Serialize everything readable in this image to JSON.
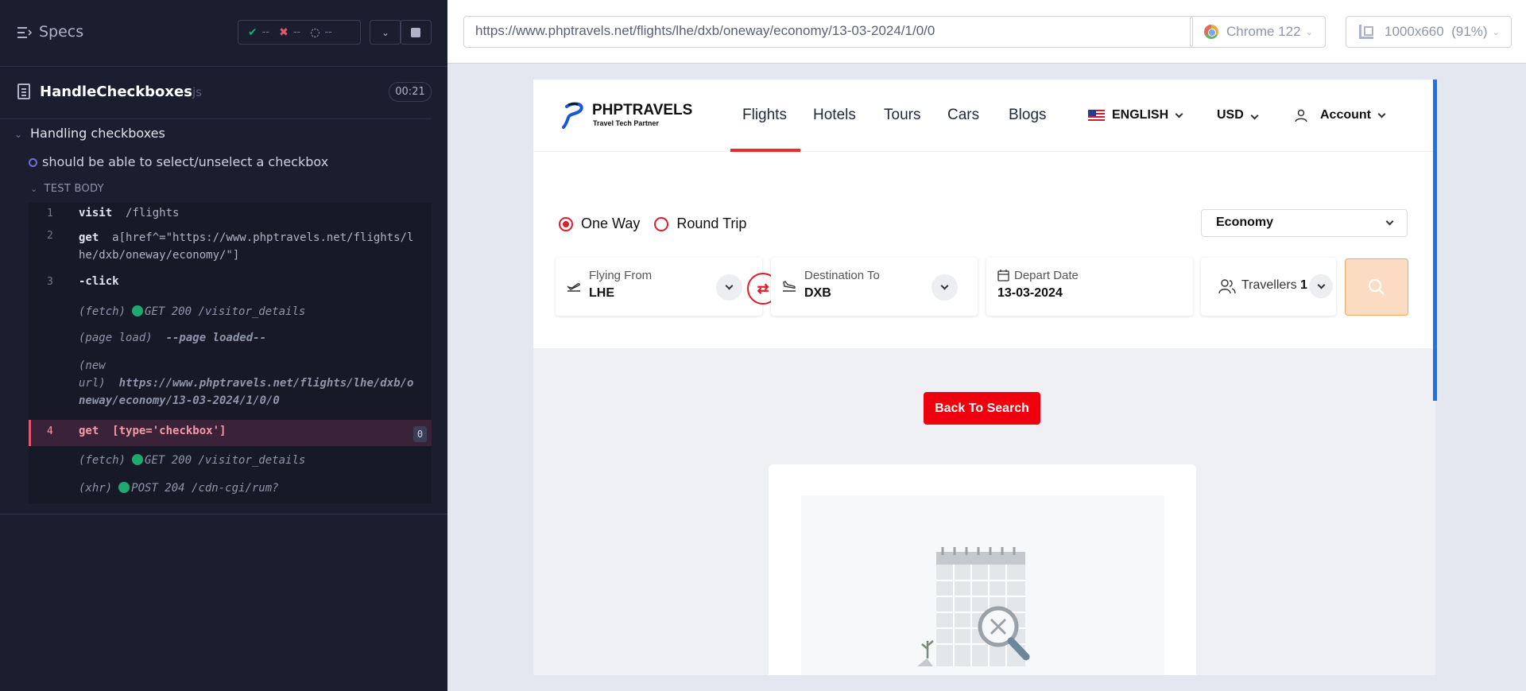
{
  "runner": {
    "specs_title": "Specs",
    "stats": {
      "passed": "--",
      "failed": "--",
      "pending": "--"
    },
    "file_name": "HandleCheckboxes",
    "file_ext": "js",
    "duration": "00:21",
    "suite_title": "Handling checkboxes",
    "test_title": "should be able to select/unselect a checkbox",
    "test_body_label": "TEST BODY",
    "commands": [
      {
        "num": "1",
        "name": "visit",
        "arg": "/flights"
      },
      {
        "num": "2",
        "name": "get",
        "arg": "a[href^=\"https://www.phptravels.net/flights/l",
        "arg2": "he/dxb/oneway/economy/\"]"
      },
      {
        "num": "3",
        "name": "-click",
        "arg": ""
      },
      {
        "num": "4",
        "name": "get",
        "arg": "[type='checkbox']",
        "count": "0"
      }
    ],
    "sub_events": {
      "fetch1": {
        "type": "(fetch)",
        "text": "GET 200 /visitor_details"
      },
      "pageload": {
        "type": "(page load)",
        "text": "--page loaded--"
      },
      "newurl": {
        "type1": "(new",
        "type2": "url)",
        "text1": "https://www.phptravels.net/flights/lhe/dxb/o",
        "text2": "neway/economy/13-03-2024/1/0/0"
      },
      "fetch2": {
        "type": "(fetch)",
        "text": "GET 200 /visitor_details"
      },
      "xhr": {
        "type": "(xhr)",
        "text": "POST 204 /cdn-cgi/rum?"
      }
    }
  },
  "browser": {
    "url": "https://www.phptravels.net/flights/lhe/dxb/oneway/economy/13-03-2024/1/0/0",
    "browser_name": "Chrome 122",
    "viewport": "1000x660",
    "zoom": "(91%)"
  },
  "site": {
    "logo_name": "PHPTRAVELS",
    "logo_tag": "Travel Tech Partner",
    "nav": [
      "Flights",
      "Hotels",
      "Tours",
      "Cars",
      "Blogs"
    ],
    "language": "ENGLISH",
    "currency": "USD",
    "account": "Account",
    "trip_types": [
      "One Way",
      "Round Trip"
    ],
    "cabin_class": "Economy",
    "from_label": "Flying From",
    "from_value": "LHE",
    "to_label": "Destination To",
    "to_value": "DXB",
    "date_label": "Depart Date",
    "date_value": "13-03-2024",
    "travellers_label": "Travellers",
    "travellers_value": "1",
    "back_button": "Back To Search"
  },
  "colors": {
    "accent_red": "#e11d2a",
    "pass_green": "#1fa971",
    "runner_bg": "#1b1e2e"
  }
}
